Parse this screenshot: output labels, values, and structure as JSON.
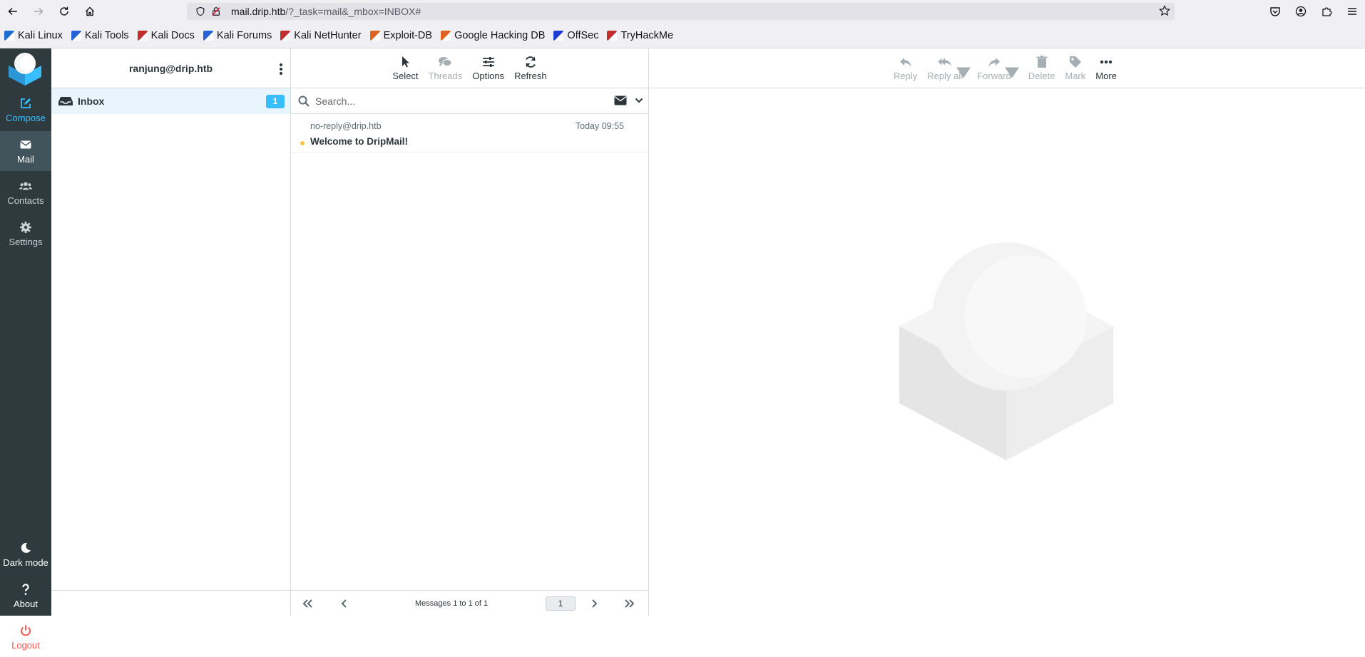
{
  "browser": {
    "url_host": "mail.drip.htb",
    "url_path": "/?_task=mail&_mbox=INBOX#",
    "bookmarks": [
      {
        "label": "Kali Linux",
        "color": "#1d6fd1"
      },
      {
        "label": "Kali Tools",
        "color": "#2563d6"
      },
      {
        "label": "Kali Docs",
        "color": "#c22d2d"
      },
      {
        "label": "Kali Forums",
        "color": "#2563d6"
      },
      {
        "label": "Kali NetHunter",
        "color": "#c22d2d"
      },
      {
        "label": "Exploit-DB",
        "color": "#e0631d"
      },
      {
        "label": "Google Hacking DB",
        "color": "#e0631d"
      },
      {
        "label": "OffSec",
        "color": "#1d3fd1"
      },
      {
        "label": "TryHackMe",
        "color": "#c22d2d"
      }
    ]
  },
  "taskmenu": {
    "compose": "Compose",
    "mail": "Mail",
    "contacts": "Contacts",
    "settings": "Settings",
    "dark_mode": "Dark mode",
    "about": "About",
    "logout": "Logout"
  },
  "folders": {
    "account": "ranjung@drip.htb",
    "items": [
      {
        "label": "Inbox",
        "unread": "1"
      }
    ]
  },
  "list_toolbar": {
    "select": "Select",
    "threads": "Threads",
    "options": "Options",
    "refresh": "Refresh"
  },
  "search": {
    "placeholder": "Search..."
  },
  "messages": [
    {
      "from": "no-reply@drip.htb",
      "date": "Today 09:55",
      "subject": "Welcome to DripMail!",
      "unread": true
    }
  ],
  "pagination": {
    "count_text": "Messages 1 to 1 of 1",
    "page": "1"
  },
  "content_toolbar": {
    "reply": "Reply",
    "reply_all": "Reply all",
    "forward": "Forward",
    "delete": "Delete",
    "mark": "Mark",
    "more": "More"
  },
  "colors": {
    "accent": "#37beff",
    "sidebar_bg": "#2f3a3f",
    "logout": "#ff5552",
    "unread_dot": "#f6c444"
  }
}
